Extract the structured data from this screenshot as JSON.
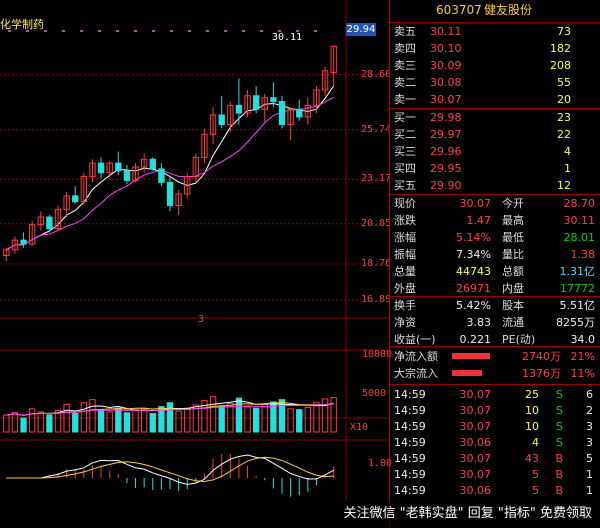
{
  "stock": {
    "code": "603707",
    "name": "健友股份"
  },
  "chart_title": "化学制药",
  "high_marker": "30.11",
  "price_flag": "29.94",
  "marker_mid": "3",
  "y_axis": [
    "28.60",
    "25.74",
    "23.17",
    "20.85",
    "18.76",
    "16.89"
  ],
  "vol_axis": [
    "10000",
    "5000",
    "X10"
  ],
  "macd_axis": [
    "1.00"
  ],
  "orderbook": {
    "asks": [
      {
        "label": "卖五",
        "price": "30.11",
        "vol": "73"
      },
      {
        "label": "卖四",
        "price": "30.10",
        "vol": "182"
      },
      {
        "label": "卖三",
        "price": "30.09",
        "vol": "208"
      },
      {
        "label": "卖二",
        "price": "30.08",
        "vol": "55"
      },
      {
        "label": "卖一",
        "price": "30.07",
        "vol": "20"
      }
    ],
    "bids": [
      {
        "label": "买一",
        "price": "29.98",
        "vol": "23"
      },
      {
        "label": "买二",
        "price": "29.97",
        "vol": "22"
      },
      {
        "label": "买三",
        "price": "29.96",
        "vol": "4"
      },
      {
        "label": "买四",
        "price": "29.95",
        "vol": "1"
      },
      {
        "label": "买五",
        "price": "29.90",
        "vol": "12"
      }
    ]
  },
  "stats": [
    {
      "l1": "现价",
      "v1": "30.07",
      "l2": "今开",
      "v2": "28.70",
      "c1": "red",
      "c2": "red"
    },
    {
      "l1": "涨跌",
      "v1": "1.47",
      "l2": "最高",
      "v2": "30.11",
      "c1": "red",
      "c2": "red"
    },
    {
      "l1": "涨幅",
      "v1": "5.14%",
      "l2": "最低",
      "v2": "28.01",
      "c1": "red",
      "c2": "green"
    },
    {
      "l1": "振幅",
      "v1": "7.34%",
      "l2": "量比",
      "v2": "1.38",
      "c1": "white",
      "c2": "red"
    },
    {
      "l1": "总量",
      "v1": "44743",
      "l2": "总额",
      "v2": "1.31亿",
      "c1": "yellow",
      "c2": "cyan"
    },
    {
      "l1": "外盘",
      "v1": "26971",
      "l2": "内盘",
      "v2": "17772",
      "c1": "red",
      "c2": "green"
    }
  ],
  "stats2": [
    {
      "l1": "换手",
      "v1": "5.42%",
      "l2": "股本",
      "v2": "5.51亿"
    },
    {
      "l1": "净资",
      "v1": "3.83",
      "l2": "流通",
      "v2": "8255万"
    },
    {
      "l1": "收益(一)",
      "v1": "0.221",
      "l2": "PE(动)",
      "v2": "34.0"
    }
  ],
  "flows": [
    {
      "label": "净流入额",
      "value": "2740万",
      "pct": "21%",
      "bar": 0.95
    },
    {
      "label": "大宗流入",
      "value": "1376万",
      "pct": "11%",
      "bar": 0.75
    }
  ],
  "ticks": [
    {
      "time": "14:59",
      "price": "30.07",
      "vol": "25",
      "side": "S",
      "n": "6"
    },
    {
      "time": "14:59",
      "price": "30.07",
      "vol": "10",
      "side": "S",
      "n": "2"
    },
    {
      "time": "14:59",
      "price": "30.07",
      "vol": "10",
      "side": "S",
      "n": "3"
    },
    {
      "time": "14:59",
      "price": "30.06",
      "vol": "4",
      "side": "S",
      "n": "3"
    },
    {
      "time": "14:59",
      "price": "30.07",
      "vol": "43",
      "side": "B",
      "n": "5"
    },
    {
      "time": "14:59",
      "price": "30.07",
      "vol": "5",
      "side": "B",
      "n": "1"
    },
    {
      "time": "14:59",
      "price": "30.06",
      "vol": "5",
      "side": "B",
      "n": "1"
    }
  ],
  "banner": "关注微信 \"老韩实盘\" 回复 \"指标\" 免费领取",
  "colors": {
    "up": "#ff3b3b",
    "down": "#22e0e0",
    "ma5": "#ffffff",
    "ma10": "#ff40ff",
    "grid": "#8a0000"
  },
  "chart_data": {
    "type": "candlestick",
    "candles": [
      [
        19.2,
        19.6,
        18.9,
        19.5
      ],
      [
        19.5,
        20.2,
        19.3,
        20.0
      ],
      [
        20.0,
        20.4,
        19.6,
        19.8
      ],
      [
        19.8,
        21.0,
        19.7,
        20.8
      ],
      [
        20.8,
        21.5,
        20.5,
        21.2
      ],
      [
        21.2,
        21.3,
        20.4,
        20.6
      ],
      [
        20.6,
        21.8,
        20.5,
        21.6
      ],
      [
        21.6,
        22.5,
        21.2,
        22.3
      ],
      [
        22.3,
        22.8,
        21.9,
        22.0
      ],
      [
        22.0,
        23.5,
        21.9,
        23.3
      ],
      [
        23.3,
        24.2,
        23.0,
        24.0
      ],
      [
        24.0,
        24.3,
        23.2,
        23.5
      ],
      [
        23.5,
        24.1,
        23.3,
        24.0
      ],
      [
        24.0,
        24.6,
        23.4,
        23.6
      ],
      [
        23.6,
        23.9,
        22.9,
        23.1
      ],
      [
        23.1,
        24.0,
        23.0,
        23.8
      ],
      [
        23.8,
        24.5,
        23.5,
        24.2
      ],
      [
        24.2,
        24.3,
        23.6,
        23.7
      ],
      [
        23.7,
        24.0,
        22.8,
        23.0
      ],
      [
        23.0,
        23.3,
        21.5,
        21.8
      ],
      [
        21.8,
        22.6,
        21.3,
        22.4
      ],
      [
        22.4,
        23.5,
        22.2,
        23.3
      ],
      [
        23.3,
        24.5,
        23.0,
        24.3
      ],
      [
        24.3,
        25.8,
        24.0,
        25.5
      ],
      [
        25.5,
        26.9,
        25.0,
        26.5
      ],
      [
        26.5,
        27.5,
        25.8,
        26.0
      ],
      [
        26.0,
        27.2,
        25.6,
        27.0
      ],
      [
        27.0,
        28.4,
        26.0,
        26.6
      ],
      [
        26.6,
        27.8,
        26.4,
        27.5
      ],
      [
        27.5,
        28.0,
        26.6,
        26.8
      ],
      [
        26.8,
        27.6,
        26.1,
        27.4
      ],
      [
        27.4,
        28.2,
        26.9,
        27.2
      ],
      [
        27.2,
        27.5,
        25.8,
        26.0
      ],
      [
        26.0,
        26.9,
        25.2,
        26.8
      ],
      [
        26.8,
        27.3,
        26.2,
        26.4
      ],
      [
        26.4,
        27.4,
        26.0,
        27.0
      ],
      [
        27.0,
        28.0,
        26.6,
        27.8
      ],
      [
        27.8,
        29.0,
        27.5,
        28.8
      ],
      [
        28.7,
        30.11,
        28.01,
        30.07
      ]
    ],
    "volume": [
      2200,
      2500,
      1800,
      3000,
      2600,
      2200,
      2800,
      3600,
      2400,
      3800,
      4200,
      2900,
      2600,
      3100,
      2500,
      2900,
      3000,
      2400,
      3300,
      3800,
      2700,
      3100,
      3500,
      4100,
      4600,
      3400,
      3700,
      4400,
      3300,
      3100,
      3600,
      3900,
      4200,
      3000,
      2900,
      3200,
      3800,
      4300,
      4474
    ],
    "ylim": [
      16.89,
      30.5
    ],
    "vol_max": 10000
  }
}
